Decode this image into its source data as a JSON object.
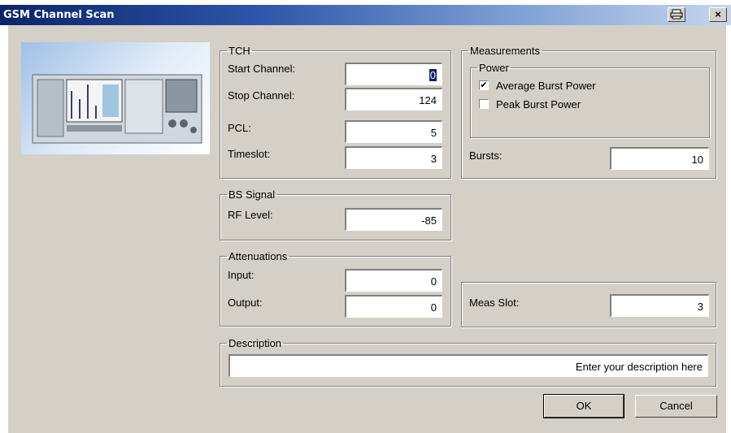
{
  "window": {
    "title": "GSM Channel Scan",
    "print_icon": "printer-icon",
    "close_icon": "close-icon",
    "close_glyph": "×"
  },
  "tch": {
    "legend": "TCH",
    "start_channel_label": "Start Channel:",
    "start_channel": "0",
    "stop_channel_label": "Stop Channel:",
    "stop_channel": "124",
    "pcl_label": "PCL:",
    "pcl": "5",
    "timeslot_label": "Timeslot:",
    "timeslot": "3"
  },
  "measurements": {
    "legend": "Measurements",
    "power_legend": "Power",
    "average_burst_power": "Average Burst Power",
    "average_checked": true,
    "peak_burst_power": "Peak Burst Power",
    "peak_checked": false,
    "check_glyph": "✔",
    "bursts_label": "Bursts:",
    "bursts": "10"
  },
  "bs_signal": {
    "legend": "BS Signal",
    "rf_level_label": "RF Level:",
    "rf_level": "-85"
  },
  "attenuations": {
    "legend": "Attenuations",
    "input_label": "Input:",
    "input": "0",
    "output_label": "Output:",
    "output": "0"
  },
  "meas_slot": {
    "label": "Meas Slot:",
    "value": "3"
  },
  "description": {
    "legend": "Description",
    "value": "Enter your description here"
  },
  "buttons": {
    "ok": "OK",
    "cancel": "Cancel"
  }
}
